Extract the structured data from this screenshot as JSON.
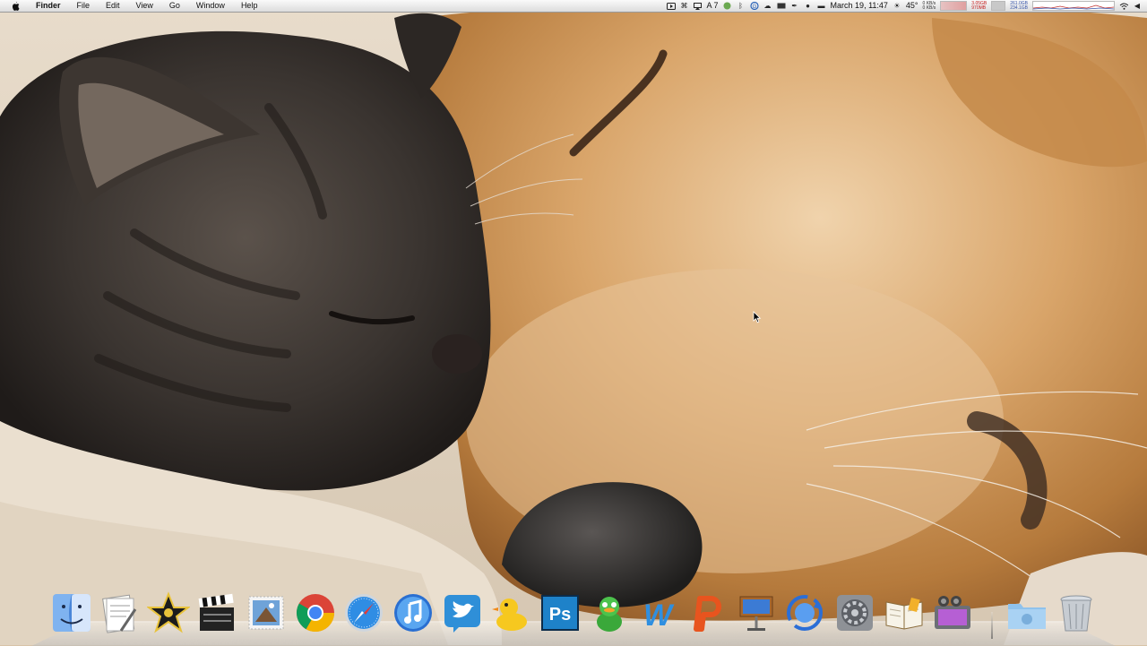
{
  "menubar": {
    "app_name": "Finder",
    "menus": [
      "File",
      "Edit",
      "View",
      "Go",
      "Window",
      "Help"
    ],
    "status": {
      "battery_or_count": "7",
      "datetime": "March 19, 11:47",
      "temperature": "45°",
      "net_up": "0 KB/s",
      "net_down": "0 KB/s",
      "mem_used": "3.05GB",
      "mem_free": "970MB",
      "disk_read": "261.0GB",
      "disk_write": "234.1GB"
    }
  },
  "dock": {
    "apps": [
      {
        "name": "Finder",
        "icon": "finder-icon"
      },
      {
        "name": "Preview",
        "icon": "preview-icon"
      },
      {
        "name": "iMovie",
        "icon": "imovie-star-icon"
      },
      {
        "name": "Final Cut",
        "icon": "clapperboard-icon"
      },
      {
        "name": "Mail",
        "icon": "mail-stamp-icon"
      },
      {
        "name": "Google Chrome",
        "icon": "chrome-icon"
      },
      {
        "name": "Safari",
        "icon": "safari-icon"
      },
      {
        "name": "iTunes",
        "icon": "itunes-icon"
      },
      {
        "name": "Twitter",
        "icon": "twitter-icon"
      },
      {
        "name": "Cyberduck",
        "icon": "duck-icon"
      },
      {
        "name": "Photoshop",
        "icon": "photoshop-icon"
      },
      {
        "name": "Adium",
        "icon": "adium-icon"
      },
      {
        "name": "Word",
        "icon": "word-icon"
      },
      {
        "name": "PowerPoint",
        "icon": "powerpoint-icon"
      },
      {
        "name": "Keynote",
        "icon": "keynote-icon"
      },
      {
        "name": "Time Machine",
        "icon": "sync-icon"
      },
      {
        "name": "System Preferences",
        "icon": "system-preferences-icon"
      },
      {
        "name": "iBooks",
        "icon": "book-icon"
      },
      {
        "name": "iPhoto",
        "icon": "iphoto-icon"
      }
    ],
    "folders": [
      {
        "name": "Downloads",
        "icon": "folder-icon"
      },
      {
        "name": "Trash",
        "icon": "trash-icon"
      }
    ],
    "photoshop_label": "Ps",
    "word_label": "W"
  },
  "colors": {
    "menubar_bg": "#e9e9e9",
    "fur_golden": "#d9a56a",
    "fur_tabby": "#3a3430",
    "blanket": "#ece0cf"
  }
}
